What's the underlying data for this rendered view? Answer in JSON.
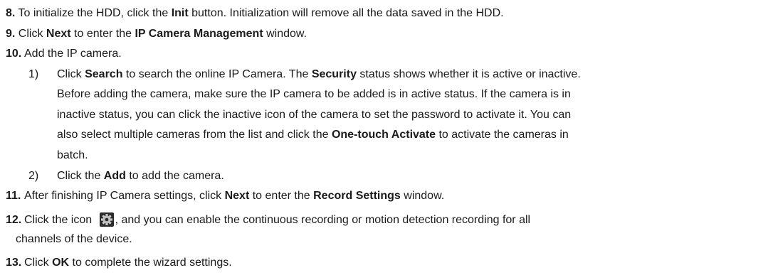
{
  "steps": {
    "s8": {
      "num": "8.",
      "t1": " To initialize the HDD, click the ",
      "b1": "Init",
      "t2": " button. Initialization will remove all the data saved in the HDD."
    },
    "s9": {
      "num": "9.",
      "t1": " Click ",
      "b1": "Next",
      "t2": " to enter the ",
      "b2": "IP Camera Management",
      "t3": " window."
    },
    "s10": {
      "num": "10.",
      "t1": "Add the IP camera.",
      "sub1": {
        "num": "1)",
        "l1a": "Click ",
        "l1b": "Search",
        "l1c": " to search the online IP Camera. The ",
        "l1d": "Security",
        "l1e": " status shows whether it is active or inactive.",
        "l2": "Before adding the camera, make sure the IP camera to be added is in active status. If the camera is in",
        "l3": "inactive status, you can click the inactive icon of the camera to set the password to activate it. You can",
        "l4a": "also select multiple cameras from the list and click the ",
        "l4b": "One-touch Activate",
        "l4c": " to activate the cameras in",
        "l5": "batch."
      },
      "sub2": {
        "num": "2)",
        "t1": "Click the ",
        "b1": "Add",
        "t2": " to add the camera."
      }
    },
    "s11": {
      "num": "11.",
      "t1": "After finishing IP Camera settings, click ",
      "b1": "Next",
      "t2": " to enter the ",
      "b2": "Record Settings",
      "t3": " window."
    },
    "s12": {
      "num": "12.",
      "t1": "Click the icon ",
      "icon": "gear-icon",
      "t2": ", and you can enable the continuous recording or motion detection recording for all",
      "t3": "channels of the device."
    },
    "s13": {
      "num": "13.",
      "t1": "Click ",
      "b1": "OK",
      "t2": " to complete the wizard settings."
    }
  }
}
